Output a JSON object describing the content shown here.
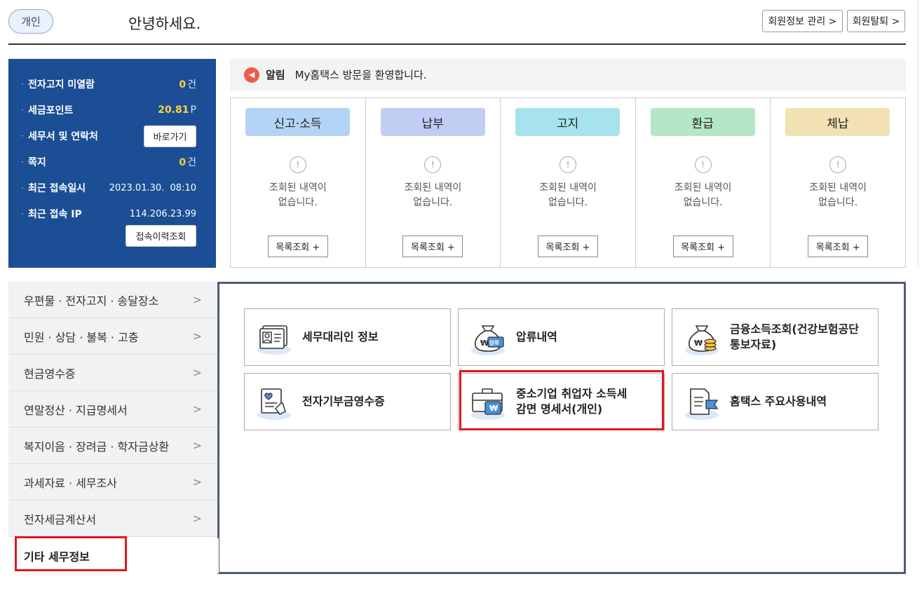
{
  "header": {
    "badge": "개인",
    "greeting": "안녕하세요.",
    "btn_member_info": "회원정보 관리 >",
    "btn_withdraw": "회원탈퇴 >"
  },
  "info_panel": {
    "unread_label": "전자고지 미열람",
    "unread_num": "0",
    "unread_unit": "건",
    "points_label": "세금포인트",
    "points_num": "20.81",
    "points_unit": "P",
    "tax_office_label": "세무서 및 연락처",
    "tax_office_btn": "바로가기",
    "memo_label": "쪽지",
    "memo_num": "0",
    "memo_unit": "건",
    "last_login_label": "최근 접속일시",
    "last_login_value": "2023.01.30.  08:10",
    "last_ip_label": "최근 접속 IP",
    "last_ip_value": "114.206.23.99",
    "history_btn": "접속이력조회"
  },
  "notice": {
    "title": "알림",
    "text": "My홈택스 방문을 환영합니다."
  },
  "categories": [
    {
      "title": "신고·소득",
      "color": "#b3d4f5",
      "empty_line1": "조회된 내역이",
      "empty_line2": "없습니다.",
      "btn": "목록조회 +"
    },
    {
      "title": "납부",
      "color": "#c2cdf4",
      "empty_line1": "조회된 내역이",
      "empty_line2": "없습니다.",
      "btn": "목록조회 +"
    },
    {
      "title": "고지",
      "color": "#a6e3ec",
      "empty_line1": "조회된 내역이",
      "empty_line2": "없습니다.",
      "btn": "목록조회 +"
    },
    {
      "title": "환급",
      "color": "#b5e6c6",
      "empty_line1": "조회된 내역이",
      "empty_line2": "없습니다.",
      "btn": "목록조회 +"
    },
    {
      "title": "체납",
      "color": "#f2e2b3",
      "empty_line1": "조회된 내역이",
      "empty_line2": "없습니다.",
      "btn": "목록조회 +"
    }
  ],
  "menu": {
    "items": [
      {
        "label": "우편물 · 전자고지 · 송달장소"
      },
      {
        "label": "민원 · 상담 · 불복 · 고충"
      },
      {
        "label": "현금영수증"
      },
      {
        "label": "연말정산 · 지급명세서"
      },
      {
        "label": "복지이음 · 장려금 · 학자금상환"
      },
      {
        "label": "과세자료 · 세무조사"
      },
      {
        "label": "전자세금계산서"
      }
    ],
    "active": "기타 세무정보"
  },
  "tiles": {
    "t1": "세무대리인 정보",
    "t2": "압류내역",
    "t2_icon_tag": "압류",
    "t3_line1": "금융소득조회(건강보험공단",
    "t3_line2": "통보자료)",
    "t4": "전자기부금영수증",
    "t5_line1": "중소기업 취업자 소득세",
    "t5_line2": "감면 명세서(개인)",
    "t6": "홈택스 주요사용내역",
    "won": "₩"
  },
  "colors": {
    "panel_blue": "#1b4e95",
    "highlight_red": "#e2171d",
    "points_yellow": "#ffd23f"
  }
}
